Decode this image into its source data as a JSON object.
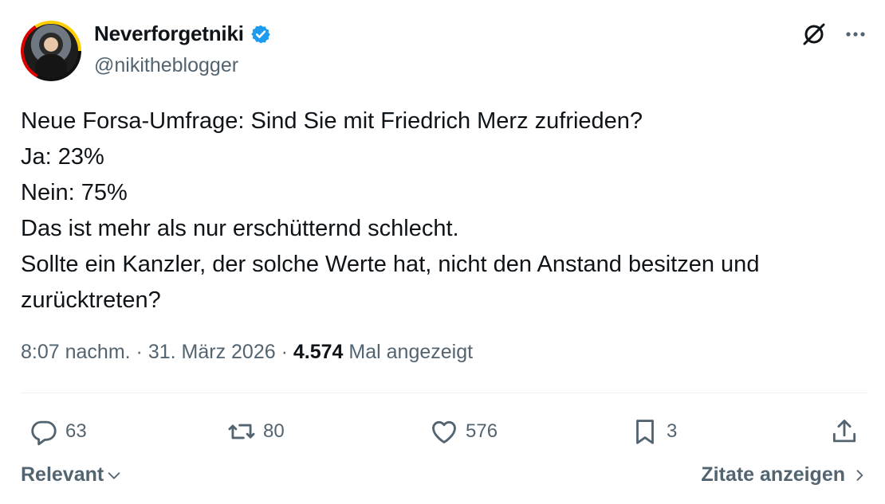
{
  "author": {
    "display_name": "Neverforgetniki",
    "handle": "@nikitheblogger",
    "verified": true,
    "verified_color": "#1d9bf0"
  },
  "tweet": {
    "lines": [
      "Neue Forsa-Umfrage: Sind Sie mit Friedrich Merz zufrieden?",
      "Ja: 23%",
      "Nein: 75%",
      "Das ist mehr als nur erschütternd schlecht.",
      "Sollte ein Kanzler, der solche Werte hat, nicht den Anstand besitzen und",
      "zurücktreten?"
    ],
    "time": "8:07 nachm.",
    "separator": "·",
    "date": "31. März 2026",
    "views_count": "4.574",
    "views_label": "Mal angezeigt"
  },
  "icons": {
    "top_left": "grok-icon",
    "top_right": "more-icon"
  },
  "actions": {
    "replies": "63",
    "reposts": "80",
    "likes": "576",
    "bookmarks": "3"
  },
  "footer": {
    "sort_label": "Relevant",
    "quotes_label": "Zitate anzeigen"
  },
  "colors": {
    "text_primary": "#0f1419",
    "text_secondary": "#536471",
    "divider": "#eff3f4",
    "accent": "#1d9bf0"
  }
}
